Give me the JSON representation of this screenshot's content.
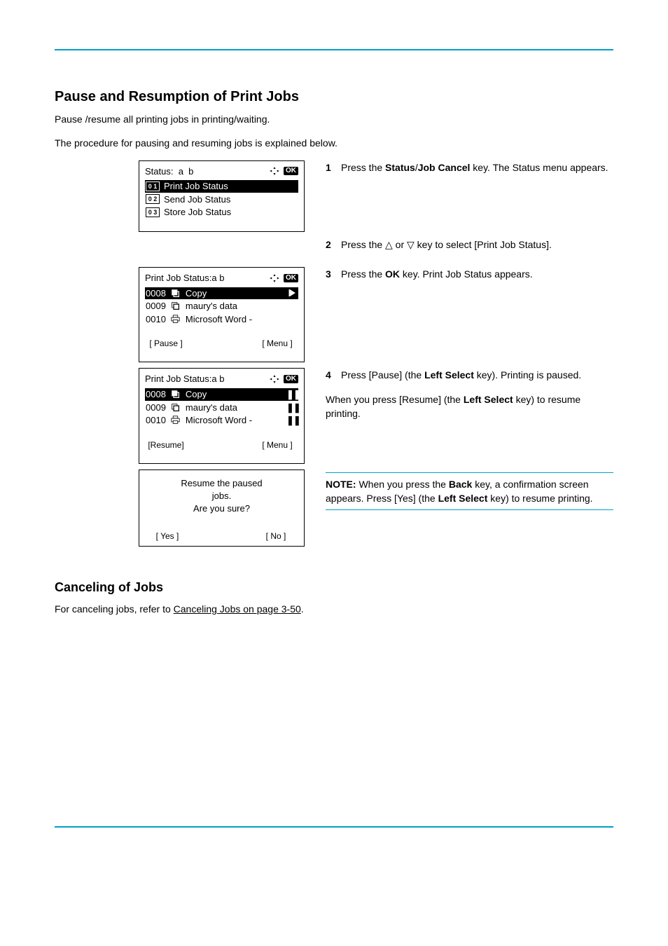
{
  "section": {
    "title": "Pause and Resumption of Print Jobs",
    "intro1": "Pause /resume all printing jobs in printing/waiting.",
    "intro2": "The procedure for pausing and resuming jobs is explained below."
  },
  "nav_ok_label": "OK",
  "steps": {
    "step1": {
      "num": "1",
      "text_a": "Press the ",
      "key1": "Status",
      "text_b": "/",
      "key2": "Job Cancel",
      "text_c": " key. The Status menu appears.",
      "lcd": {
        "title": "Status:",
        "lines": [
          {
            "num": "0 1",
            "label": "Print Job Status",
            "selected": true
          },
          {
            "num": "0 2",
            "label": "Send Job Status",
            "selected": false
          },
          {
            "num": "0 3",
            "label": "Store Job Status",
            "selected": false
          }
        ]
      }
    },
    "step2": {
      "num": "2",
      "text": "Press the △ or ▽ key to select [Print Job Status]."
    },
    "step3": {
      "num": "3",
      "text_a": "Press the ",
      "key": "OK",
      "text_b": " key. Print Job Status appears.",
      "lcd": {
        "title": "Print Job Status:",
        "lines": [
          {
            "id": "0008",
            "icon": "copy",
            "label": "Copy",
            "right": "play",
            "selected": true
          },
          {
            "id": "0009",
            "icon": "copy",
            "label": "maury's data",
            "right": "",
            "selected": false
          },
          {
            "id": "0010",
            "icon": "print",
            "label": "Microsoft Word -",
            "right": "",
            "selected": false
          }
        ],
        "soft": {
          "left": "[ Pause ]",
          "right": "[ Menu ]"
        }
      }
    },
    "step4": {
      "num": "4",
      "text_a": "Press [Pause] (the ",
      "key1": "Left Select",
      "text_b": " key). Printing is paused.",
      "text_c": "When you press [Resume] (the ",
      "key2": "Left Select",
      "text_d": " key) to resume printing.",
      "lcd": {
        "title": "Print Job Status:",
        "lines": [
          {
            "id": "0008",
            "icon": "copy",
            "label": "Copy",
            "right": "pause",
            "selected": true
          },
          {
            "id": "0009",
            "icon": "copy",
            "label": "maury's data",
            "right": "pause",
            "selected": false
          },
          {
            "id": "0010",
            "icon": "print",
            "label": "Microsoft Word -",
            "right": "pause",
            "selected": false
          }
        ],
        "soft": {
          "left": "[Resume]",
          "right": "[ Menu ]"
        }
      }
    },
    "note": {
      "label": "NOTE:",
      "text_a": " When you press the ",
      "key1": "Back",
      "text_b": " key, a confirmation screen appears. Press [Yes] (the ",
      "key2": "Left Select",
      "text_c": " key) to resume printing.",
      "confirm": {
        "line1": "Resume the paused",
        "line2": "jobs.",
        "line3": "Are you sure?",
        "left": "[  Yes  ]",
        "right": "[  No  ]"
      }
    }
  },
  "cancel": {
    "title": "Canceling of Jobs",
    "text_a": "For canceling jobs, refer to ",
    "link": "Canceling Jobs on page 3-50",
    "text_b": "."
  }
}
